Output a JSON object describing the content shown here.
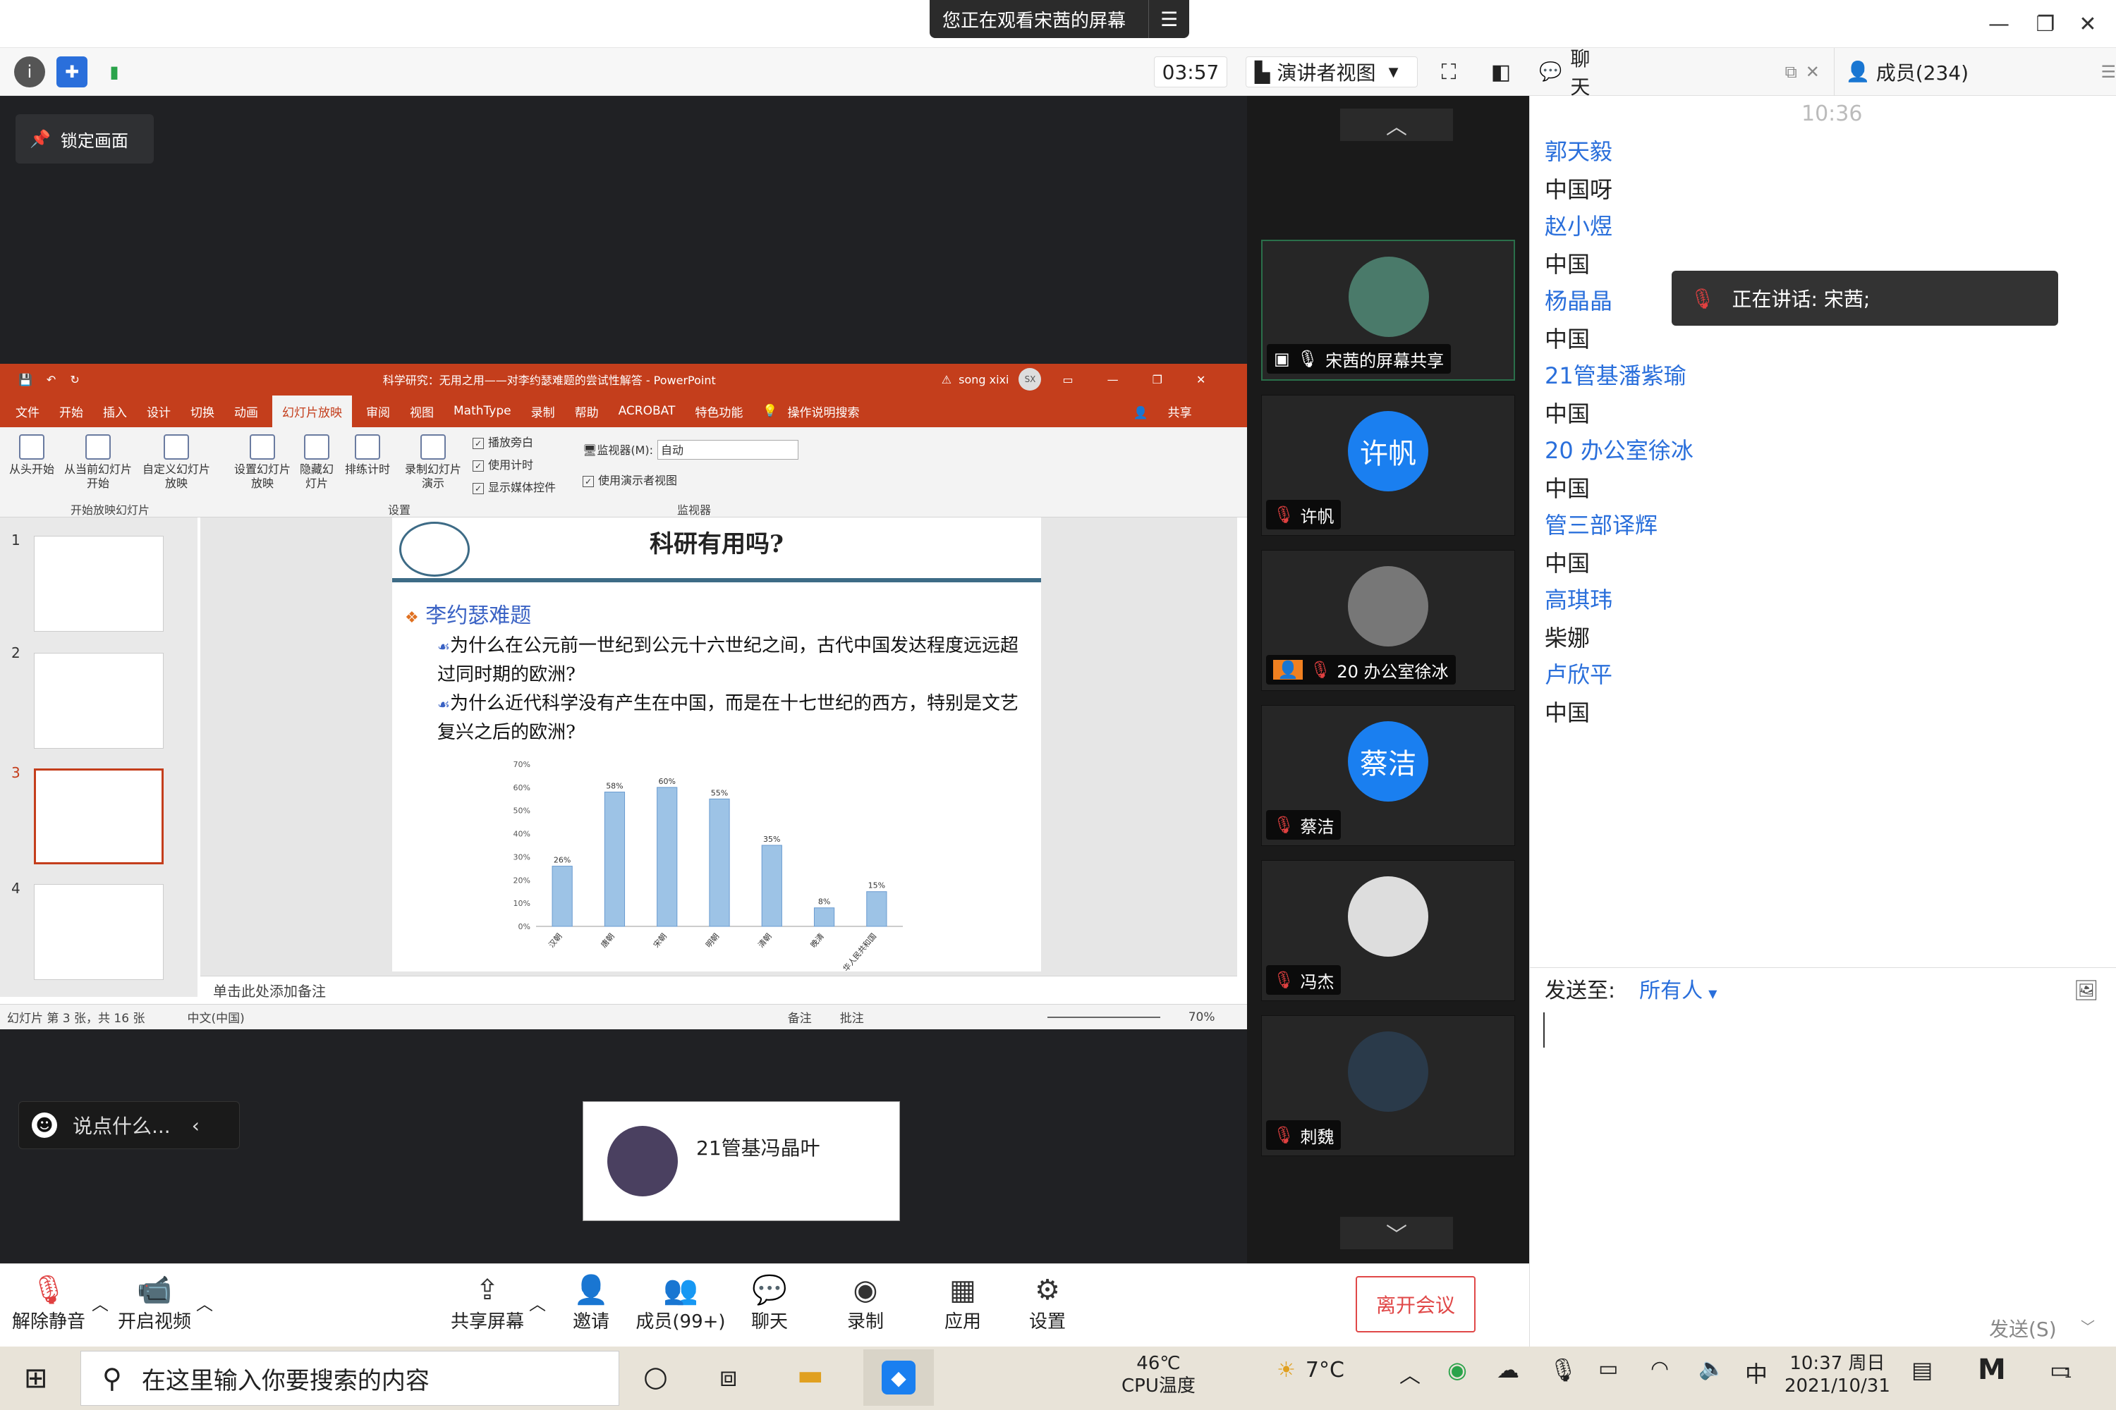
{
  "banner": {
    "text": "您正在观看宋茜的屏幕",
    "menu_icon": "list-icon"
  },
  "toolbar": {
    "timer": "03:57",
    "view_mode": "演讲者视图"
  },
  "lock_label": "锁定画面",
  "ppt": {
    "title": "科学研究：无用之用——对李约瑟难题的尝试性解答 - PowerPoint",
    "user": "song xixi",
    "user_initials": "SX",
    "menu": [
      "文件",
      "开始",
      "插入",
      "设计",
      "切换",
      "动画",
      "幻灯片放映",
      "审阅",
      "视图",
      "MathType",
      "录制",
      "帮助",
      "ACROBAT",
      "特色功能",
      "操作说明搜索"
    ],
    "active_menu": "幻灯片放映",
    "share": "共享",
    "ribbon": {
      "from_start": "从头开始",
      "from_current": "从当前幻灯片开始",
      "custom": "自定义幻灯片放映",
      "group1": "开始放映幻灯片",
      "setup": "设置幻灯片放映",
      "hide": "隐藏幻灯片",
      "rehearse": "排练计时",
      "record": "录制幻灯片演示",
      "chk_narration": "播放旁白",
      "chk_timing": "使用计时",
      "chk_media": "显示媒体控件",
      "group2": "设置",
      "monitor_label": "监视器(M):",
      "monitor_value": "自动",
      "presenter_view": "使用演示者视图",
      "group3": "监视器"
    },
    "thumb_numbers": [
      "1",
      "2",
      "3",
      "4"
    ],
    "slide": {
      "title": "科研有用吗?",
      "heading": "李约瑟难题",
      "q1": "为什么在公元前一世纪到公元十六世纪之间，古代中国发达程度远远超过同时期的欧洲?",
      "q2": "为什么近代科学没有产生在中国，而是在十七世纪的西方，特别是文艺复兴之后的欧洲?"
    },
    "notes": "单击此处添加备注",
    "status_left": "幻灯片 第 3 张，共 16 张",
    "status_lang": "中文(中国)",
    "status_notes": "备注",
    "status_comments": "批注",
    "zoom": "70%"
  },
  "chart_data": {
    "type": "bar",
    "categories": [
      "汉朝",
      "唐朝",
      "宋朝",
      "明朝",
      "清朝",
      "晚清",
      "华人民共和国"
    ],
    "values": [
      26,
      58,
      60,
      55,
      35,
      8,
      15
    ],
    "value_labels": [
      "26%",
      "58%",
      "60%",
      "55%",
      "35%",
      "8%",
      "15%"
    ],
    "y_ticks": [
      "70%",
      "60%",
      "50%",
      "40%",
      "30%",
      "20%",
      "10%",
      "0%"
    ],
    "ylim": [
      0,
      70
    ],
    "color": "#9dc3e6"
  },
  "say_placeholder": "说点什么...",
  "speaker_card_name": "21管基冯晶叶",
  "participants": [
    {
      "name": "宋茜的屏幕共享"
    },
    {
      "name": "许帆",
      "avatar": "许帆",
      "color": "#1a7ff0"
    },
    {
      "name": "20 办公室徐冰"
    },
    {
      "name": "蔡洁",
      "avatar": "蔡洁",
      "color": "#1a7ff0"
    },
    {
      "name": "冯杰"
    },
    {
      "name": "刺魏"
    }
  ],
  "bottom": {
    "unmute": "解除静音",
    "video": "开启视频",
    "share": "共享屏幕",
    "invite": "邀请",
    "members": "成员(99+)",
    "chat": "聊天",
    "record": "录制",
    "apps": "应用",
    "settings": "设置",
    "leave": "离开会议"
  },
  "chat": {
    "tab": "聊天",
    "members_tab": "成员(234)",
    "time": "10:36",
    "messages": [
      {
        "name": "郭天毅",
        "text": "中国呀"
      },
      {
        "name": "赵小煜",
        "text": "中国"
      },
      {
        "name": "杨晶晶",
        "text": "中国"
      },
      {
        "name": "21管基潘紫瑜",
        "text": "中国"
      },
      {
        "name": " 20 办公室徐冰",
        "text": "中国"
      },
      {
        "name": "管三部译辉",
        "text": "中国"
      },
      {
        "name": "高琪玮",
        "text": "柴娜"
      },
      {
        "name": "卢欣平",
        "text": "中国"
      }
    ],
    "speaking": "正在讲话: 宋茜;",
    "send_to_label": "发送至:",
    "send_to_value": "所有人",
    "send_button": "发送(S)"
  },
  "taskbar": {
    "search": "在这里输入你要搜索的内容",
    "cpu_temp": "46℃",
    "cpu_label": "CPU温度",
    "weather": "7°C",
    "ime": "中",
    "time": "10:37 周日",
    "date": "2021/10/31",
    "notif": "1"
  }
}
